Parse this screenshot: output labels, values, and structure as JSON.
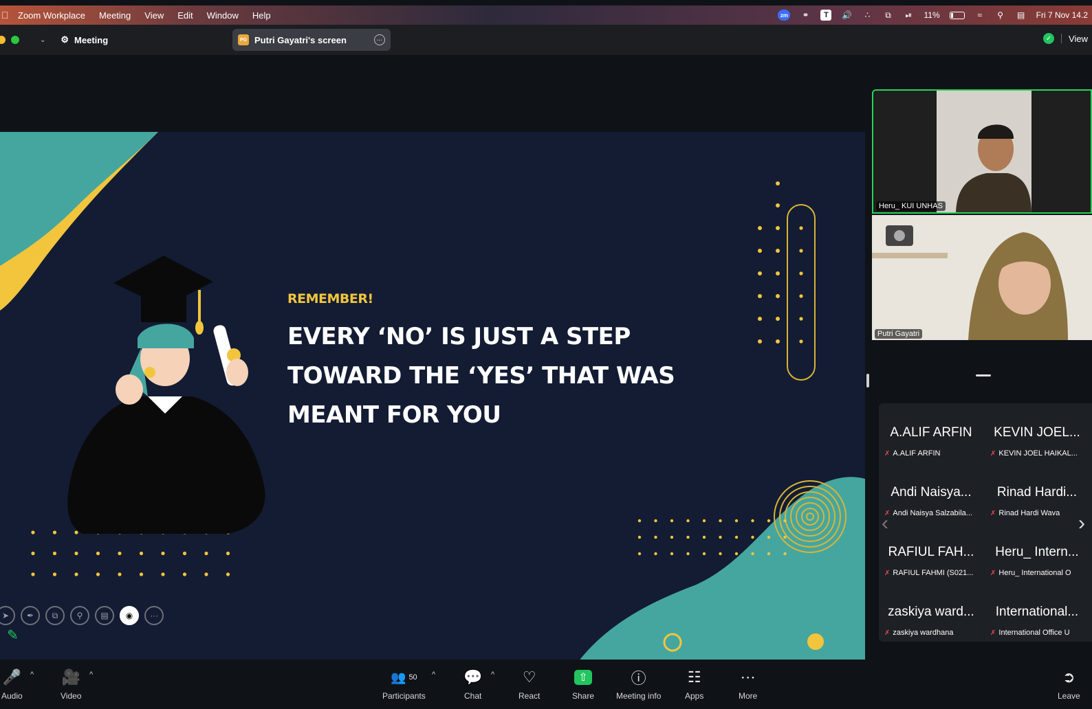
{
  "menubar": {
    "app_name": "Zoom Workplace",
    "menus": [
      "Meeting",
      "View",
      "Edit",
      "Window",
      "Help"
    ],
    "status_icons": [
      "zoom-status-icon",
      "creative-cloud-icon",
      "t-app-icon",
      "volume-icon",
      "dots-icon",
      "window-icon",
      "play-icon"
    ],
    "battery": "11%",
    "datetime": "Fri 7 Nov 14.2"
  },
  "titlebar": {
    "meeting_label": "Meeting",
    "screen_tab_label": "Putri Gayatri's screen",
    "screen_badge": "PG",
    "view_label": "View"
  },
  "slide": {
    "remember": "REMEMBER!",
    "quote_lines": [
      "EVERY ‘NO’ IS JUST A STEP",
      "TOWARD THE ‘YES’ THAT WAS",
      "MEANT FOR YOU"
    ],
    "colors": {
      "background": "#131c33",
      "yellow": "#f2c53d",
      "teal": "#45a6a0"
    }
  },
  "videos": {
    "speaker1": "Heru_ KUI UNHAS",
    "speaker2": "Putri Gayatri"
  },
  "gallery": [
    {
      "big": "A.ALIF ARFIN",
      "small": "A.ALIF ARFIN"
    },
    {
      "big": "KEVIN JOEL...",
      "small": "KEVIN JOEL HAIKAL..."
    },
    {
      "big": "Andi Naisya...",
      "small": "Andi Naisya Salzabila..."
    },
    {
      "big": "Rinad Hardi...",
      "small": "Rinad Hardi Wava"
    },
    {
      "big": "RAFIUL FAH...",
      "small": "RAFIUL FAHMI (S021..."
    },
    {
      "big": "Heru_ Intern...",
      "small": "Heru_ International O"
    },
    {
      "big": "zaskiya ward...",
      "small": "zaskiya wardhana"
    },
    {
      "big": "International...",
      "small": "International Office U"
    }
  ],
  "controls": {
    "audio": "Audio",
    "video": "Video",
    "participants": "Participants",
    "participants_count": "50",
    "chat": "Chat",
    "react": "React",
    "share": "Share",
    "meeting_info": "Meeting info",
    "apps": "Apps",
    "more": "More",
    "leave": "Leave"
  }
}
